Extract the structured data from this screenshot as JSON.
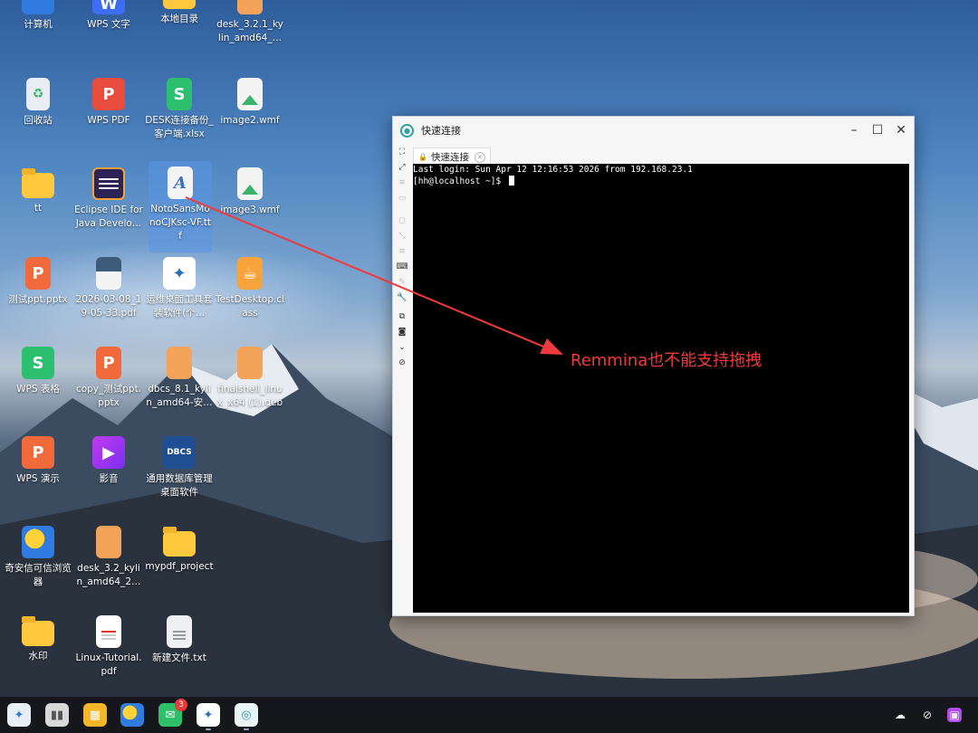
{
  "desktop_icons": [
    {
      "label": "计算机",
      "icon": "computer-icon"
    },
    {
      "label": "WPS 文字",
      "icon": "wps-writer-icon"
    },
    {
      "label": "本地目录",
      "icon": "folder-icon"
    },
    {
      "label": "desk_3.2.1_kylin_amd64_…",
      "icon": "package-icon"
    },
    {
      "label": "回收站",
      "icon": "trash-icon"
    },
    {
      "label": "WPS PDF",
      "icon": "wps-pdf-icon"
    },
    {
      "label": "DESK连接备份_客户端.xlsx",
      "icon": "spreadsheet-icon"
    },
    {
      "label": "image2.wmf",
      "icon": "image-file-icon"
    },
    {
      "label": "tt",
      "icon": "folder-icon"
    },
    {
      "label": "Eclipse IDE for Java Develo…",
      "icon": "eclipse-icon"
    },
    {
      "label": "NotoSansMonoCJKsc-VF.ttf",
      "icon": "font-file-icon"
    },
    {
      "label": "image3.wmf",
      "icon": "image-file-icon"
    },
    {
      "label": "测试ppt.pptx",
      "icon": "presentation-icon"
    },
    {
      "label": "2026-03-08_19-05-33.pdf",
      "icon": "pdf-file-icon"
    },
    {
      "label": "运维桌面工具套装软件(个…",
      "icon": "ops-tool-icon"
    },
    {
      "label": "TestDesktop.class",
      "icon": "java-class-icon"
    },
    {
      "label": "WPS 表格",
      "icon": "wps-sheet-icon"
    },
    {
      "label": "copy_测试ppt.pptx",
      "icon": "presentation-icon"
    },
    {
      "label": "dbcs_8.1_kylin_amd64-安…",
      "icon": "package-icon"
    },
    {
      "label": "finalshell_linux_x64 (1).deb",
      "icon": "package-icon"
    },
    {
      "label": "WPS 演示",
      "icon": "wps-presentation-icon"
    },
    {
      "label": "影音",
      "icon": "video-player-icon"
    },
    {
      "label": "通用数据库管理桌面软件",
      "icon": "database-icon"
    },
    {
      "label": "奇安信可信浏览器",
      "icon": "browser-icon"
    },
    {
      "label": "desk_3.2_kylin_amd64_2…",
      "icon": "package-icon"
    },
    {
      "label": "mypdf_project",
      "icon": "folder-icon"
    },
    {
      "label": "水印",
      "icon": "folder-icon"
    },
    {
      "label": "Linux-Tutorial.pdf",
      "icon": "pdf-file-icon"
    },
    {
      "label": "新建文件.txt",
      "icon": "text-file-icon"
    }
  ],
  "window": {
    "title": "快速连接",
    "tab_label": "快速连接",
    "terminal_lines": [
      "Last login: Sun Apr 12 12:16:53 2026 from 192.168.23.1",
      "[hh@localhost ~]$ "
    ]
  },
  "annotation": {
    "text": "Remmina也不能支持拖拽",
    "color": "#f0393a"
  },
  "taskbar": {
    "badge_count": "3"
  }
}
